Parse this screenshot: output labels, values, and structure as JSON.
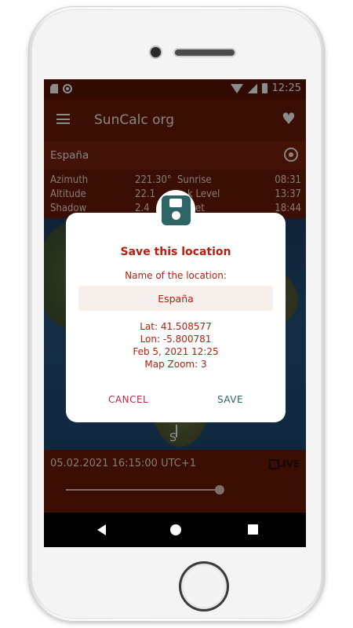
{
  "status_bar": {
    "time": "12:25"
  },
  "app_bar": {
    "title": "SunCalc org"
  },
  "location_bar": {
    "location": "España"
  },
  "sun_info": [
    {
      "label": "Azimuth",
      "value": "221.30°",
      "label2": "Sunrise",
      "value2": "08:31"
    },
    {
      "label": "Altitude",
      "value": "22.1",
      "label2": "k Level",
      "value2": "13:37"
    },
    {
      "label": "Shadow",
      "value": "2.4",
      "label2": "et",
      "value2": "18:44"
    }
  ],
  "map": {
    "direction_label": "S"
  },
  "bottom_bar": {
    "datetime": "05.02.2021 16:15:00 UTC+1",
    "live_label": "LIVE"
  },
  "dialog": {
    "title": "Save this location",
    "name_label": "Name of the location:",
    "name_value": "España",
    "lat": "Lat: 41.508577",
    "lon": "Lon: -5.800781",
    "date": "Feb 5, 2021 12:25",
    "zoom": "Map Zoom: 3",
    "cancel_label": "CANCEL",
    "save_label": "SAVE"
  },
  "colors": {
    "primary": "#6a1b07",
    "accent_red": "#b3200f",
    "teal": "#2e6466"
  }
}
